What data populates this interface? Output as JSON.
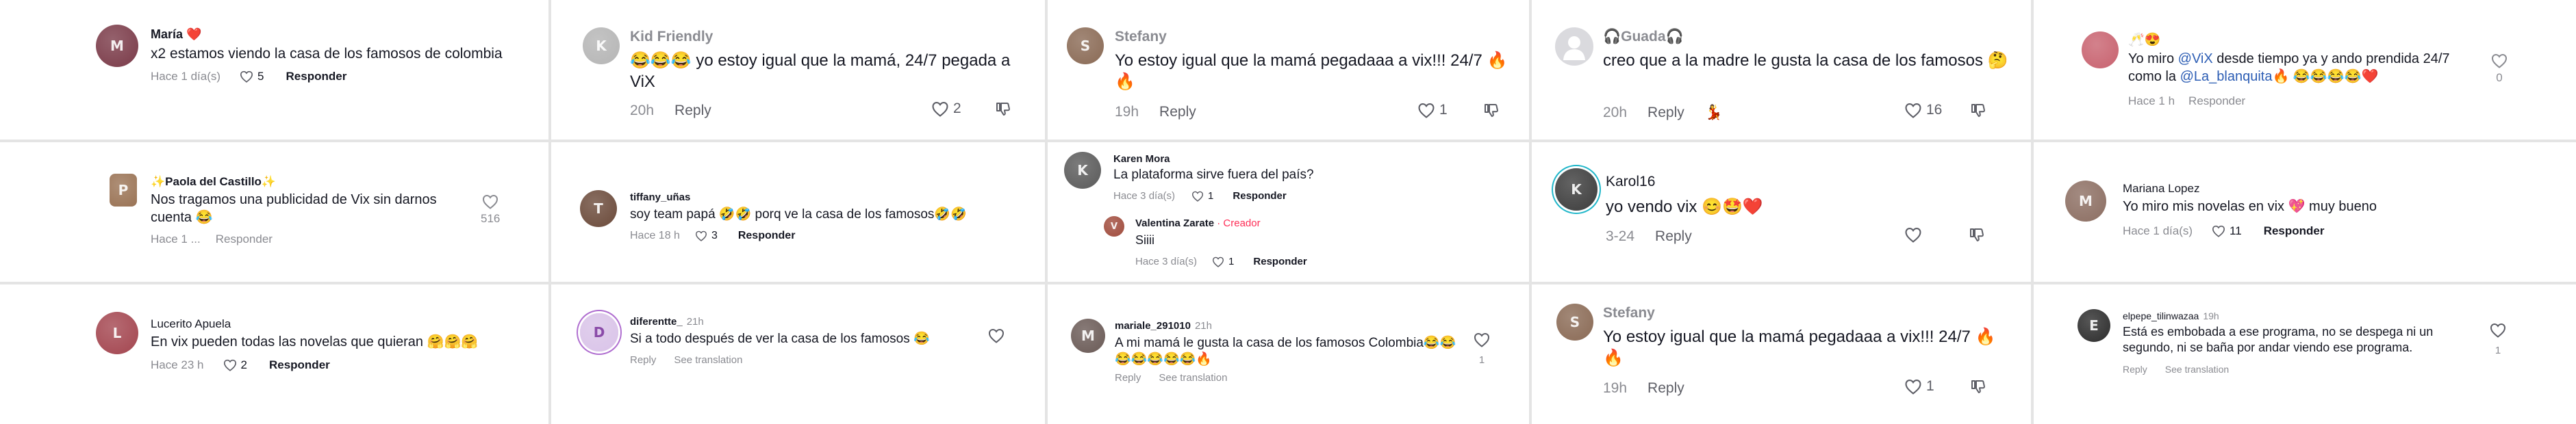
{
  "colors": {
    "background": "#ffffff",
    "divider": "#e4e4e4",
    "text": "#161823",
    "muted": "#8a8b91",
    "mention": "#2c5db4",
    "creator_badge": "#fe2c55",
    "heart_filled": "#fe2c55"
  },
  "comments": [
    {
      "id": "maria",
      "username": "María ❤️",
      "text": "x2 estamos viendo la casa de los famosos de colombia",
      "time": "Hace 1 día(s)",
      "likes": "5",
      "reply": "Responder",
      "avatar_icon": "avatar",
      "avatar_color": "#7a3a48"
    },
    {
      "id": "kid-friendly",
      "username": "Kid Friendly",
      "text": "😂😂😂 yo estoy igual que la mamá, 24/7 pegada a ViX",
      "time": "20h",
      "reply": "Reply",
      "likes": "2",
      "avatar_color": "#b5b5b5"
    },
    {
      "id": "stefany-1",
      "username": "Stefany",
      "text": "Yo estoy igual que la mamá pegadaaa a vix!!! 24/7 🔥🔥",
      "time": "19h",
      "reply": "Reply",
      "likes": "1",
      "avatar_color": "#8a6a55"
    },
    {
      "id": "guada",
      "username": "🎧Guada🎧",
      "text": "creo que a la madre le gusta la casa de los famosos 🤔",
      "time": "20h",
      "reply": "Reply",
      "likes": "16",
      "badge_icon": "💃",
      "avatar_color": "#cfcfd6"
    },
    {
      "id": "vix-fan",
      "username": "🥂😍",
      "text_parts": {
        "before": "Yo miro ",
        "mention1": "@ViX",
        "middle": " desde tiempo ya y ando prendida 24/7 como la ",
        "mention2": "@La_blanquita",
        "after": "🔥 😂😂😂😂❤️"
      },
      "time": "Hace 1 h",
      "reply": "Responder",
      "likes": "0",
      "avatar_color": "#c8626f"
    },
    {
      "id": "paola",
      "username": "✨Paola del Castillo✨",
      "text": "Nos tragamos una publicidad de Vix sin darnos cuenta 😂",
      "time": "Hace 1 ...",
      "reply": "Responder",
      "likes": "516",
      "avatar_color": "#9a7355"
    },
    {
      "id": "tiffany",
      "username": "tiffany_uñas",
      "text": "soy team papá 🤣🤣 porq ve la casa de los famosos🤣🤣",
      "time": "Hace 18 h",
      "likes": "3",
      "reply": "Responder",
      "avatar_color": "#6b4a3a"
    },
    {
      "id": "karen",
      "username": "Karen Mora",
      "text": "La plataforma sirve fuera del país?",
      "time": "Hace 3 día(s)",
      "likes": "1",
      "reply": "Responder",
      "avatar_color": "#5a5a5a"
    },
    {
      "id": "valentina",
      "username": "Valentina Zarate",
      "creator_label": " · Creador",
      "text": "Siiii",
      "time": "Hace 3 día(s)",
      "likes": "1",
      "reply": "Responder",
      "avatar_color": "#a04b3c"
    },
    {
      "id": "karol",
      "username": "Karol16",
      "text": "yo vendo vix 😊🤩❤️",
      "time": "3-24",
      "reply": "Reply",
      "avatar_color": "#3c3c3c",
      "ring_color": "#1fb6c9"
    },
    {
      "id": "mariana",
      "username": "Mariana Lopez",
      "text": "Yo miro mis novelas en vix 💖 muy bueno",
      "time": "Hace 1 día(s)",
      "likes": "11",
      "reply": "Responder",
      "avatar_color": "#8c6e62"
    },
    {
      "id": "lucerito",
      "username": "Lucerito Apuela",
      "text": "En vix pueden todas las novelas que quieran 🤗🤗🤗",
      "time": "Hace 23 h",
      "likes": "2",
      "reply": "Responder",
      "avatar_color": "#a3454f"
    },
    {
      "id": "diferentte",
      "username": "diferentte_",
      "time_inline": "21h",
      "text": "Si a todo después de ver la casa de los famosos 😂",
      "reply": "Reply",
      "translate": "See translation",
      "avatar_color": "#d9c3e8",
      "ring_color": "#b06fd0"
    },
    {
      "id": "mariale",
      "username": "mariale_291010",
      "time_inline": "21h",
      "text": "A mi mamá le gusta la casa de los famosos Colombia😂😂😂😂😂😂😂🔥",
      "reply": "Reply",
      "translate": "See translation",
      "likes": "1",
      "avatar_color": "#6a5a56"
    },
    {
      "id": "stefany-2",
      "username": "Stefany",
      "text": "Yo estoy igual que la mamá pegadaaa a vix!!! 24/7 🔥🔥",
      "time": "19h",
      "reply": "Reply",
      "likes": "1",
      "avatar_color": "#8a6a55"
    },
    {
      "id": "elpepe",
      "username": "elpepe_tilinwazaa",
      "time_inline": "19h",
      "text": "Está es embobada a ese programa, no se despega ni un segundo, ni se baña por andar viendo ese programa.",
      "reply": "Reply",
      "translate": "See translation",
      "likes": "1",
      "avatar_color": "#2c2c2c"
    }
  ]
}
